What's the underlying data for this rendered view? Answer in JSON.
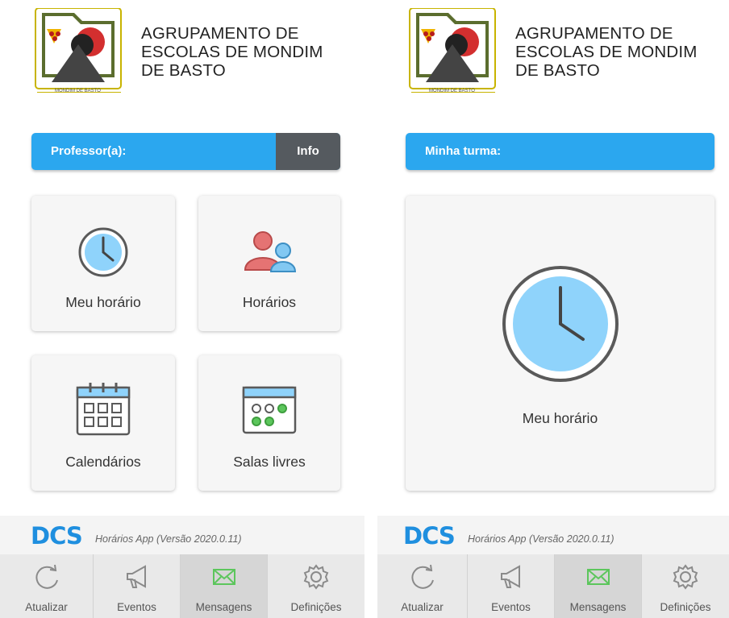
{
  "left": {
    "school_name": [
      "AGRUPAMENTO DE",
      "ESCOLAS DE MONDIM",
      "DE BASTO"
    ],
    "logo_caption": "MONDIM DE BASTO",
    "bar": {
      "label": "Professor(a):",
      "info_button": "Info"
    },
    "tiles": [
      {
        "label": "Meu horário",
        "icon": "clock-icon"
      },
      {
        "label": "Horários",
        "icon": "people-icon"
      },
      {
        "label": "Calendários",
        "icon": "calendar-icon"
      },
      {
        "label": "Salas livres",
        "icon": "free-rooms-calendar-icon"
      }
    ],
    "footer": {
      "brand": "DCS",
      "version": "Horários App (Versão 2020.0.11)"
    },
    "tabs": [
      {
        "label": "Atualizar",
        "icon": "refresh-icon"
      },
      {
        "label": "Eventos",
        "icon": "megaphone-icon"
      },
      {
        "label": "Mensagens",
        "icon": "envelope-icon"
      },
      {
        "label": "Definições",
        "icon": "gear-icon"
      }
    ]
  },
  "right": {
    "school_name": [
      "AGRUPAMENTO DE",
      "ESCOLAS DE MONDIM",
      "DE BASTO"
    ],
    "logo_caption": "MONDIM DE BASTO",
    "bar": {
      "label": "Minha turma:"
    },
    "tiles": [
      {
        "label": "Meu horário",
        "icon": "clock-icon"
      }
    ],
    "footer": {
      "brand": "DCS",
      "version": "Horários App (Versão 2020.0.11)"
    },
    "tabs": [
      {
        "label": "Atualizar",
        "icon": "refresh-icon"
      },
      {
        "label": "Eventos",
        "icon": "megaphone-icon"
      },
      {
        "label": "Mensagens",
        "icon": "envelope-icon"
      },
      {
        "label": "Definições",
        "icon": "gear-icon"
      }
    ]
  },
  "colors": {
    "accent_blue": "#2ba7ef",
    "info_button": "#555a5f",
    "clock_face": "#8fd3fb",
    "people_red": "#e57373",
    "people_blue": "#82c8f2",
    "envelope_green": "#5cc65c",
    "dcs_blue": "#1f8fdf"
  },
  "active_tab": "Mensagens"
}
